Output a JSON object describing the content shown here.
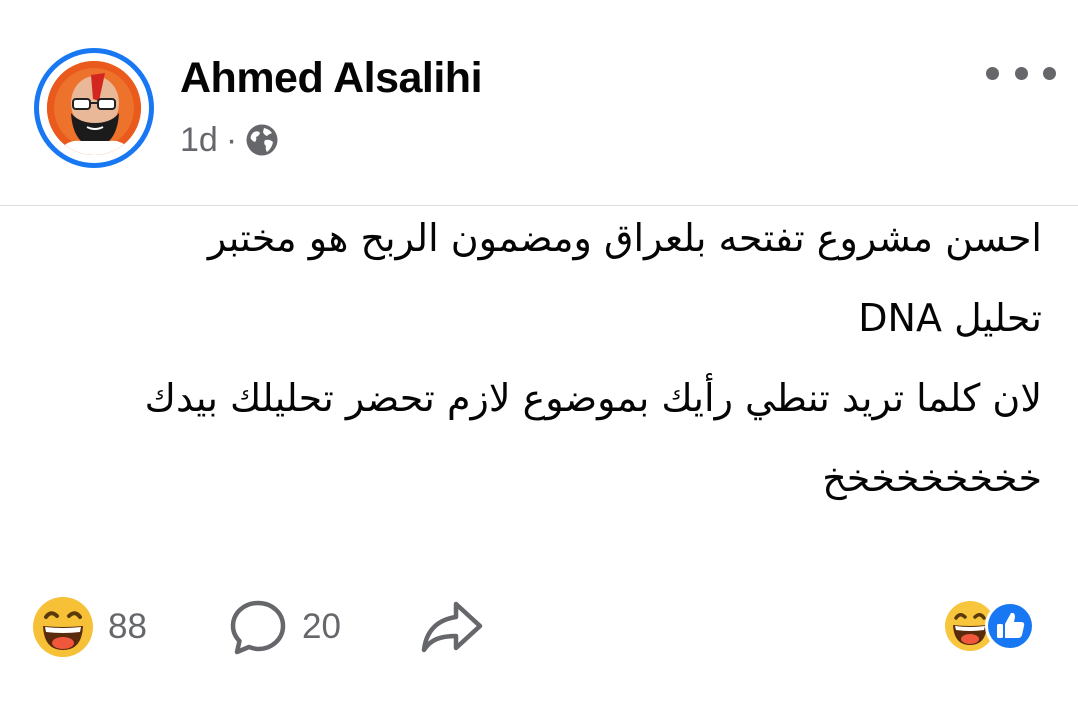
{
  "post": {
    "author_name": "Ahmed Alsalihi",
    "time_ago": "1d",
    "separator": "·",
    "privacy_icon": "globe-icon",
    "more_icon": "more-options-icon",
    "body_lines": [
      "احسن مشروع تفتحه بلعراق ومضمون الربح هو مختبر",
      "تحليل DNA",
      "لان كلما تريد تنطي رأيك بموضوع لازم تحضر تحليلك بيدك",
      "خخخخخخخخخ"
    ]
  },
  "footer": {
    "reaction_icon": "haha-reaction-icon",
    "reaction_count": "88",
    "comment_icon": "comment-icon",
    "comment_count": "20",
    "share_icon": "share-icon",
    "reaction_summary_icons": [
      "haha-reaction-icon",
      "like-reaction-icon"
    ]
  },
  "colors": {
    "accent": "#1877f2",
    "secondary_text": "#65676b",
    "haha_yellow": "#f7c63c",
    "avatar_orange": "#ea5a1c"
  }
}
